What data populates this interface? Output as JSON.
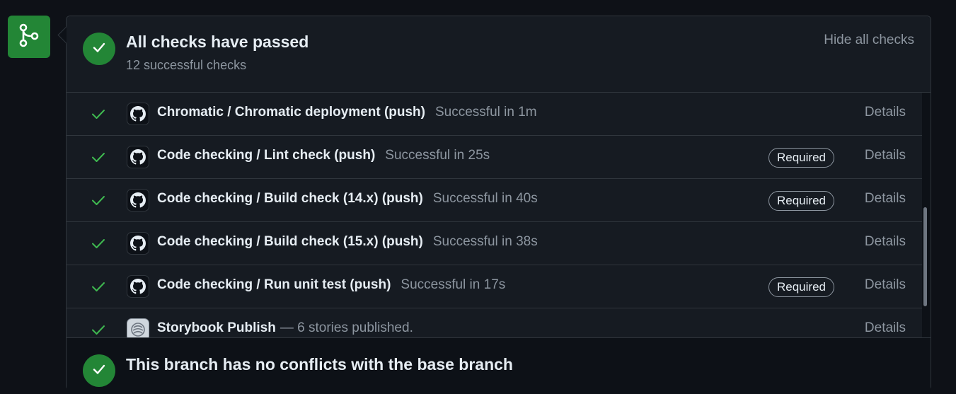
{
  "merge_icon": "git-merge-icon",
  "header": {
    "title": "All checks have passed",
    "subtitle": "12 successful checks",
    "hide_link": "Hide all checks"
  },
  "checks": [
    {
      "name": "Chromatic / Chromatic deployment (push)",
      "status": "Successful in 1m",
      "required": "",
      "details": "Details",
      "icon": "github-icon"
    },
    {
      "name": "Code checking / Lint check (push)",
      "status": "Successful in 25s",
      "required": "Required",
      "details": "Details",
      "icon": "github-icon"
    },
    {
      "name": "Code checking / Build check (14.x) (push)",
      "status": "Successful in 40s",
      "required": "Required",
      "details": "Details",
      "icon": "github-icon"
    },
    {
      "name": "Code checking / Build check (15.x) (push)",
      "status": "Successful in 38s",
      "required": "",
      "details": "Details",
      "icon": "github-icon"
    },
    {
      "name": "Code checking / Run unit test (push)",
      "status": "Successful in 17s",
      "required": "Required",
      "details": "Details",
      "icon": "github-icon"
    },
    {
      "name": "Storybook Publish",
      "status": "— 6 stories published.",
      "required": "",
      "details": "Details",
      "icon": "storybook-icon"
    }
  ],
  "branch": {
    "title": "This branch has no conflicts with the base branch"
  },
  "colors": {
    "success": "#238636",
    "tick": "#3fb950",
    "muted": "#8d96a0"
  }
}
